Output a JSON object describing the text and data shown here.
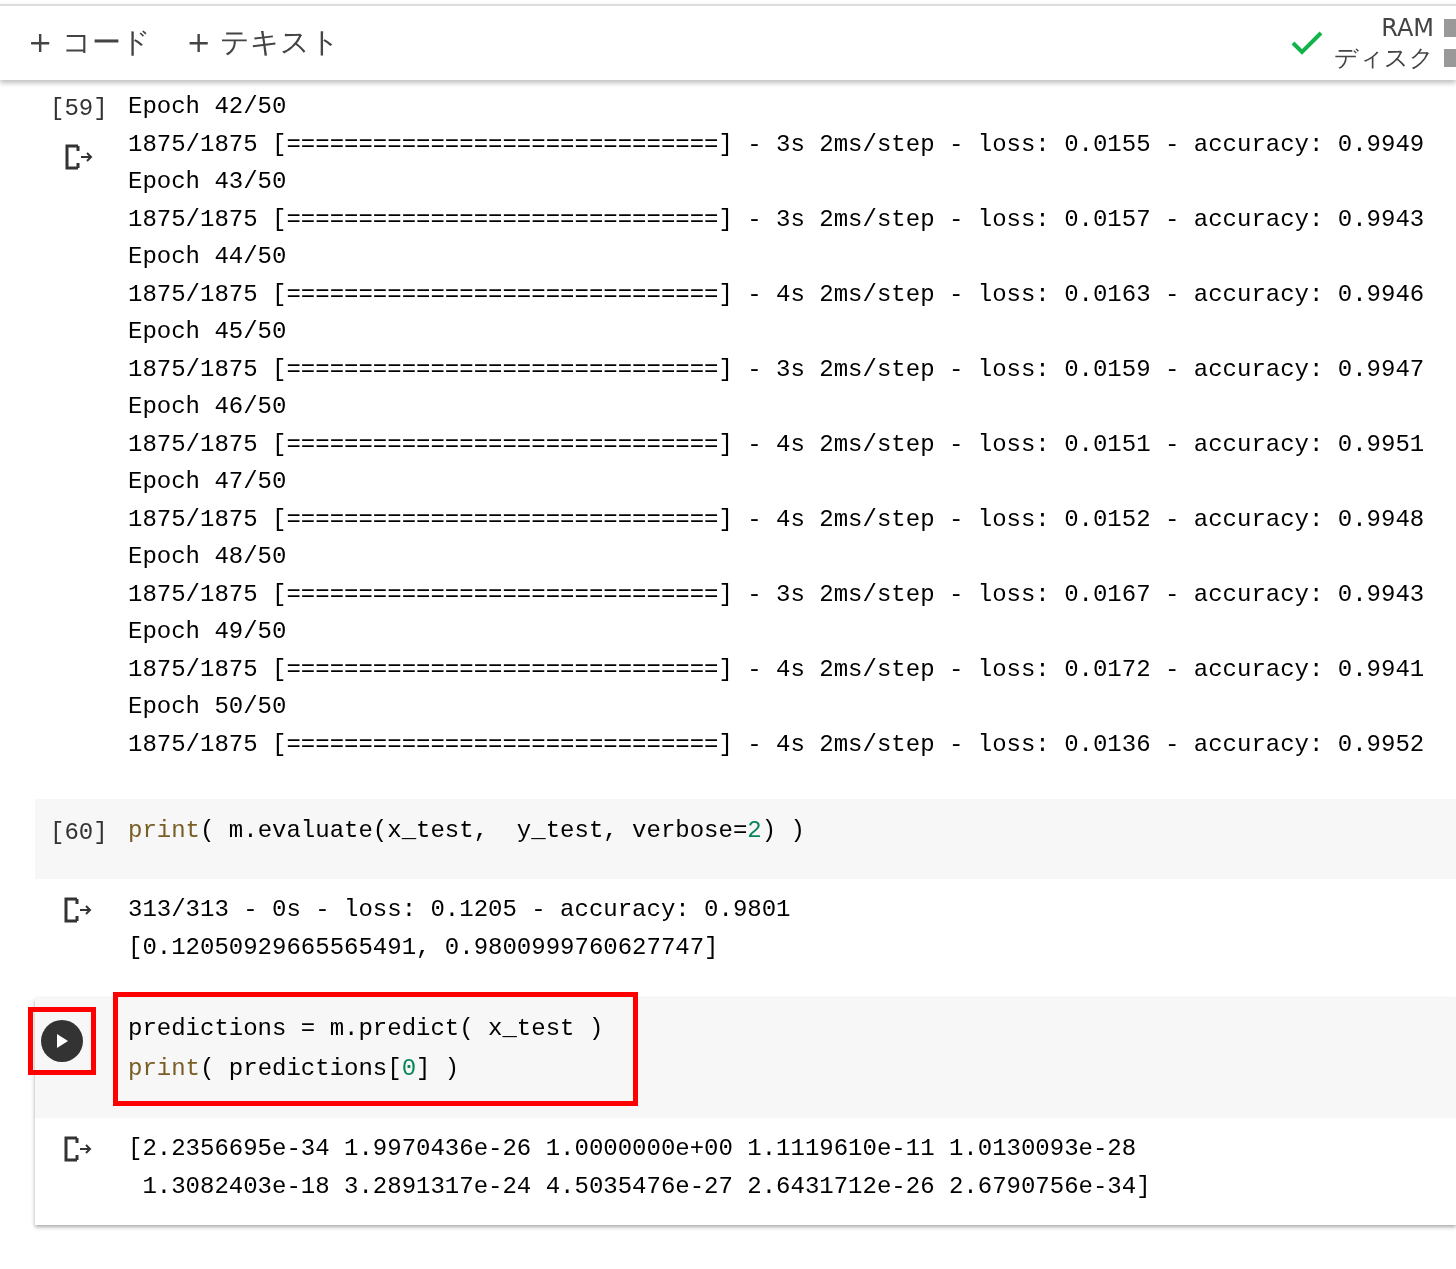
{
  "toolbar": {
    "buttons": [
      {
        "icon": "+",
        "label": "コード"
      },
      {
        "icon": "+",
        "label": "テキスト"
      }
    ],
    "status": {
      "connected": true,
      "ram_label": "RAM",
      "disk_label": "ディスク"
    }
  },
  "cells": [
    {
      "kind": "output_only",
      "count": "[59]",
      "output": [
        "Epoch 42/50",
        "1875/1875 [==============================] - 3s 2ms/step - loss: 0.0155 - accuracy: 0.9949",
        "Epoch 43/50",
        "1875/1875 [==============================] - 3s 2ms/step - loss: 0.0157 - accuracy: 0.9943",
        "Epoch 44/50",
        "1875/1875 [==============================] - 4s 2ms/step - loss: 0.0163 - accuracy: 0.9946",
        "Epoch 45/50",
        "1875/1875 [==============================] - 3s 2ms/step - loss: 0.0159 - accuracy: 0.9947",
        "Epoch 46/50",
        "1875/1875 [==============================] - 4s 2ms/step - loss: 0.0151 - accuracy: 0.9951",
        "Epoch 47/50",
        "1875/1875 [==============================] - 4s 2ms/step - loss: 0.0152 - accuracy: 0.9948",
        "Epoch 48/50",
        "1875/1875 [==============================] - 3s 2ms/step - loss: 0.0167 - accuracy: 0.9943",
        "Epoch 49/50",
        "1875/1875 [==============================] - 4s 2ms/step - loss: 0.0172 - accuracy: 0.9941",
        "Epoch 50/50",
        "1875/1875 [==============================] - 4s 2ms/step - loss: 0.0136 - accuracy: 0.9952"
      ]
    },
    {
      "kind": "code",
      "count": "[60]",
      "selected": false,
      "highlighted": false,
      "code": [
        [
          {
            "kind": "builtin",
            "text": "print"
          },
          {
            "kind": "plain",
            "text": "( m.evaluate(x_test,  y_test, verbose="
          },
          {
            "kind": "number",
            "text": "2"
          },
          {
            "kind": "plain",
            "text": ") )"
          }
        ]
      ],
      "output": [
        "313/313 - 0s - loss: 0.1205 - accuracy: 0.9801",
        "[0.12050929665565491, 0.9800999760627747]"
      ]
    },
    {
      "kind": "code",
      "selected": true,
      "highlighted": true,
      "code": [
        [
          {
            "kind": "plain",
            "text": "predictions = m.predict( x_test )"
          }
        ],
        [
          {
            "kind": "builtin",
            "text": "print"
          },
          {
            "kind": "plain",
            "text": "( predictions["
          },
          {
            "kind": "number",
            "text": "0"
          },
          {
            "kind": "plain",
            "text": "] )"
          }
        ]
      ],
      "output": [
        "[2.2356695e-34 1.9970436e-26 1.0000000e+00 1.1119610e-11 1.0130093e-28",
        " 1.3082403e-18 3.2891317e-24 4.5035476e-27 2.6431712e-26 2.6790756e-34]"
      ]
    }
  ]
}
